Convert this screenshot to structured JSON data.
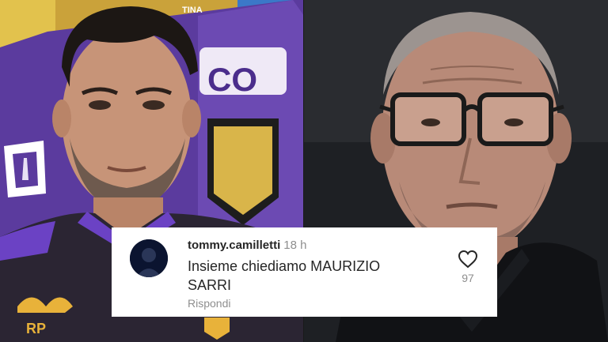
{
  "comment": {
    "username": "tommy.camilletti",
    "time_ago": "18 h",
    "text": "Insieme chiediamo MAURIZIO SARRI",
    "reply_label": "Rispondi",
    "like_count": "97"
  },
  "left_photo": {
    "bench_lettering": "TINA",
    "bench_logo": "CO",
    "shirt_initials": "RP"
  },
  "colors": {
    "fiorentina_purple": "#5c3aa0",
    "card_background": "#ffffff",
    "text_primary": "#262626",
    "text_secondary": "#8e8e8e"
  },
  "icons": {
    "like": "heart-outline-icon",
    "avatar": "user-avatar"
  }
}
